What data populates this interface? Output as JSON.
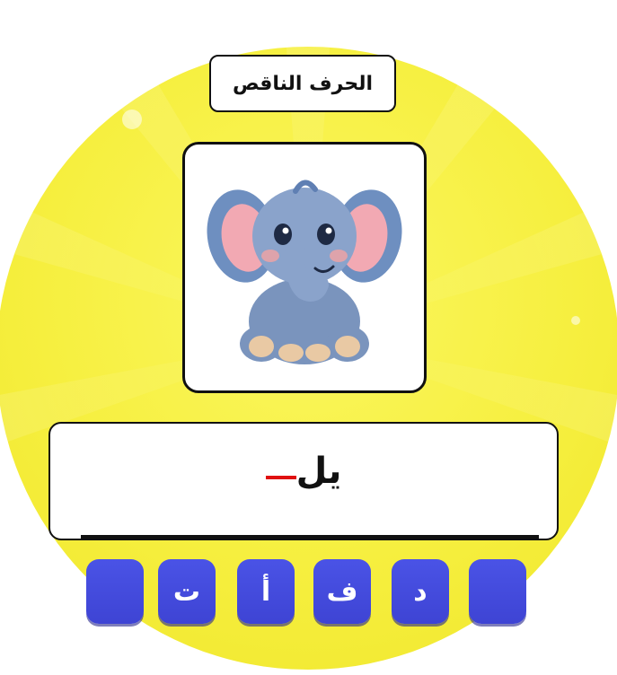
{
  "game": {
    "title": "الحرف الناقص",
    "image_subject": "elephant",
    "word_visible": "يل",
    "blank_color": "#e01010",
    "choices": [
      "",
      "ت",
      "أ",
      "ف",
      "د",
      ""
    ]
  },
  "colors": {
    "background_disc": "#f6ef3f",
    "choice_button": "#4a53e6"
  }
}
